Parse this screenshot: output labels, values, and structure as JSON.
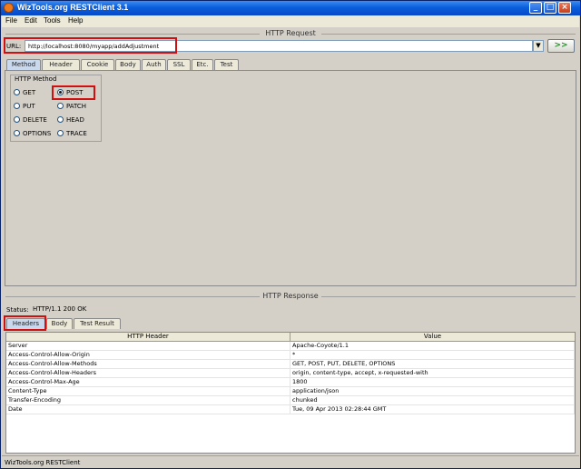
{
  "window": {
    "title": "WizTools.org RESTClient 3.1"
  },
  "menu": [
    "File",
    "Edit",
    "Tools",
    "Help"
  ],
  "request": {
    "section_title": "HTTP Request",
    "url_label": "URL:",
    "url_value": "http://localhost:8080/myapp/addAdjustment",
    "go_label": ">>",
    "tabs": [
      "Method",
      "Header",
      "Cookie",
      "Body",
      "Auth",
      "SSL",
      "Etc.",
      "Test"
    ],
    "active_tab": "Method",
    "method_group_title": "HTTP Method",
    "methods": [
      "GET",
      "POST",
      "PUT",
      "PATCH",
      "DELETE",
      "HEAD",
      "OPTIONS",
      "TRACE"
    ],
    "selected_method": "POST"
  },
  "response": {
    "section_title": "HTTP Response",
    "status_label": "Status:",
    "status_value": "HTTP/1.1 200 OK",
    "tabs": [
      "Headers",
      "Body",
      "Test Result"
    ],
    "active_tab": "Headers",
    "columns": [
      "HTTP Header",
      "Value"
    ],
    "rows": [
      [
        "Server",
        "Apache-Coyote/1.1"
      ],
      [
        "Access-Control-Allow-Origin",
        "*"
      ],
      [
        "Access-Control-Allow-Methods",
        "GET, POST, PUT, DELETE, OPTIONS"
      ],
      [
        "Access-Control-Allow-Headers",
        "origin, content-type, accept, x-requested-with"
      ],
      [
        "Access-Control-Max-Age",
        "1800"
      ],
      [
        "Content-Type",
        "application/json"
      ],
      [
        "Transfer-Encoding",
        "chunked"
      ],
      [
        "Date",
        "Tue, 09 Apr 2013 02:28:44 GMT"
      ]
    ]
  },
  "statusbar": {
    "text": "WizTools.org RESTClient"
  },
  "colors": {
    "titlebar": "#0a5fdc",
    "highlight": "#d01010",
    "active_tab": "#c9d8ec"
  }
}
